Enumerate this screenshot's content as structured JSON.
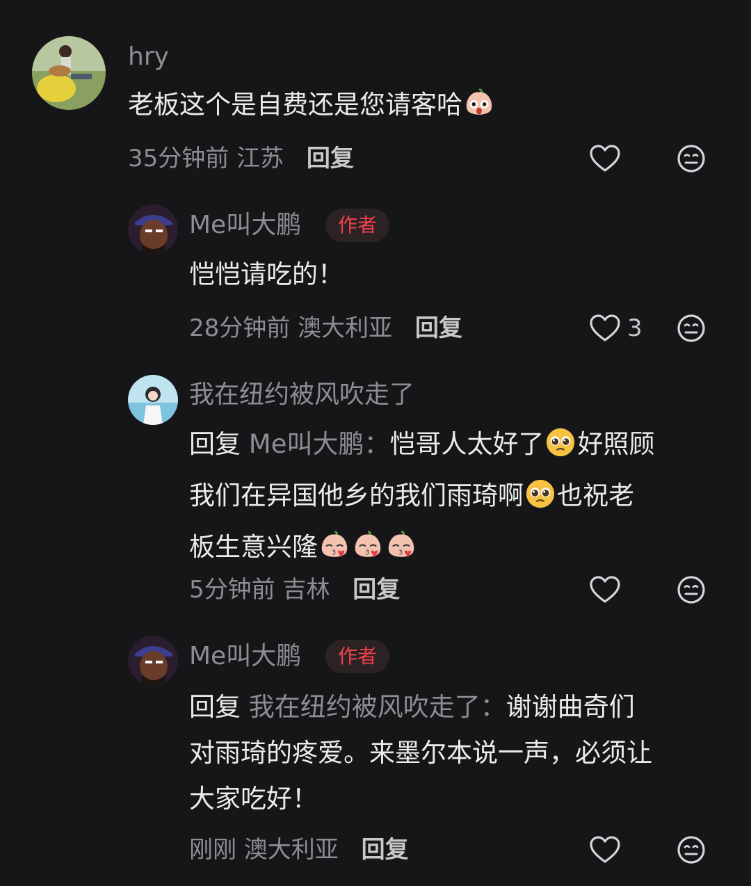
{
  "comments": [
    {
      "user": "hry",
      "text": "老板这个是自费还是您请客哈",
      "time": "35分钟前",
      "location": "江苏",
      "reply_label": "回复",
      "likes": ""
    },
    {
      "user": "Me叫大鹏",
      "badge": "作者",
      "text": "恺恺请吃的！",
      "time": "28分钟前",
      "location": "澳大利亚",
      "reply_label": "回复",
      "likes": "3"
    },
    {
      "user": "我在纽约被风吹走了",
      "reply_prefix": "回复",
      "reply_target": "Me叫大鹏：",
      "text_line1": "恺哥人太好了",
      "text_line1b": "好照顾",
      "text_line2": "我们在异国他乡的我们雨琦啊",
      "text_line2b": "也祝老",
      "text_line3": "板生意兴隆",
      "time": "5分钟前",
      "location": "吉林",
      "reply_label": "回复",
      "likes": ""
    },
    {
      "user": "Me叫大鹏",
      "badge": "作者",
      "reply_prefix": "回复",
      "reply_target": "我在纽约被风吹走了：",
      "text_line1": "谢谢曲奇们",
      "text_line2": "对雨琦的疼爱。来墨尔本说一声，必须让",
      "text_line3": "大家吃好！",
      "time": "刚刚",
      "location": "澳大利亚",
      "reply_label": "回复",
      "likes": ""
    }
  ],
  "icons": {
    "like": "heart-outline-icon",
    "dislike": "meh-face-icon",
    "emoji_surprised": "peach-surprised-emoji",
    "emoji_pleading": "pleading-face-emoji",
    "emoji_kiss": "peach-kiss-emoji"
  },
  "colors": {
    "background": "#161619",
    "author_badge": "#f1404b"
  }
}
